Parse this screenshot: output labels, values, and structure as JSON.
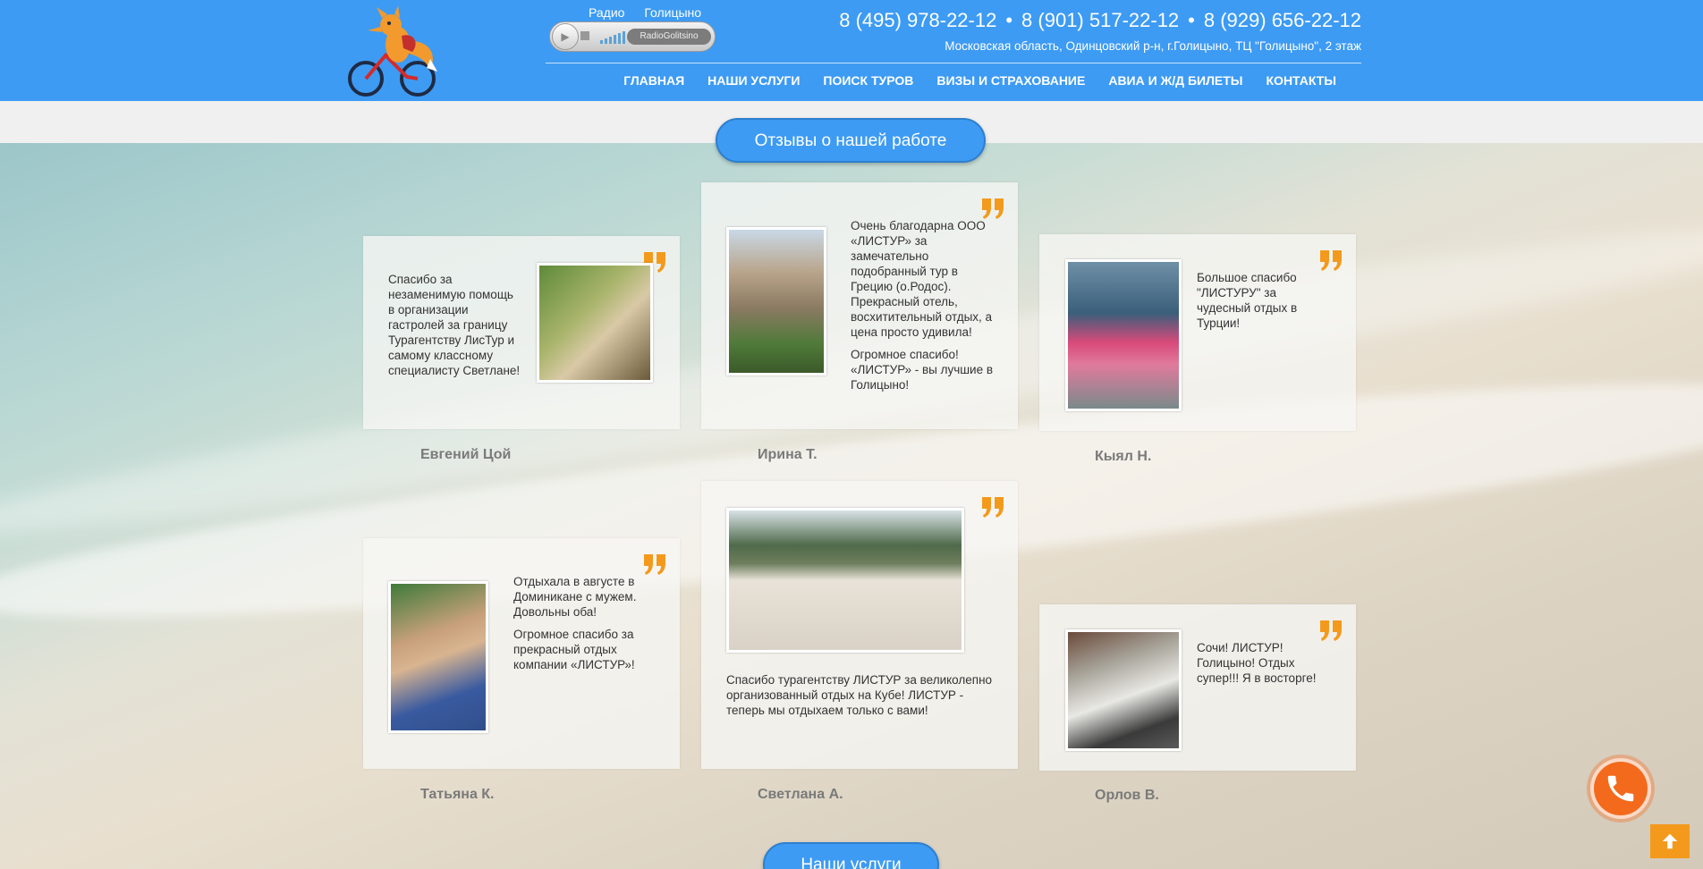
{
  "header": {
    "radio": {
      "label1": "Радио",
      "label2": "Голицыно",
      "station": "RadioGolitsino"
    },
    "phones": [
      "8 (495) 978-22-12",
      "8 (901) 517-22-12",
      "8 (929) 656-22-12"
    ],
    "phone_sep": "•",
    "address": "Московская область, Одинцовский р-н, г.Голицыно, ТЦ \"Голицыно\", 2 этаж",
    "nav": [
      "ГЛАВНАЯ",
      "НАШИ УСЛУГИ",
      "ПОИСК ТУРОВ",
      "ВИЗЫ И СТРАХОВАНИЕ",
      "АВИА И Ж/Д БИЛЕТЫ",
      "КОНТАКТЫ"
    ]
  },
  "reviews_title": "Отзывы о нашей работе",
  "services_title": "Наши услуги",
  "reviews": [
    {
      "name": "Евгений Цой",
      "paragraphs": [
        "Спасибо за незаменимую помощь в организации гастролей за границу Турагентству ЛисТур и самому классному специалисту Светлане!"
      ]
    },
    {
      "name": "Ирина Т.",
      "paragraphs": [
        "Очень благодарна ООО «ЛИСТУР» за замечательно подобранный тур в Грецию (о.Родос). Прекрасный отель, восхитительный отдых, а цена просто удивила!",
        "Огромное спасибо! «ЛИСТУР» - вы лучшие в Голицыно!"
      ]
    },
    {
      "name": "Кыял Н.",
      "paragraphs": [
        "Большое спасибо \"ЛИСТУРУ\" за чудесный отдых в Турции!"
      ]
    },
    {
      "name": "Татьяна К.",
      "paragraphs": [
        "Отдыхала в августе в Доминикане с мужем. Довольны оба!",
        "Огромное спасибо за прекрасный отдых компании «ЛИСТУР»!"
      ]
    },
    {
      "name": "Светлана А.",
      "paragraphs": [
        "Спасибо турагентству ЛИСТУР за великолепно организованный отдых на Кубе! ЛИСТУР - теперь мы отдыхаем только с вами!"
      ]
    },
    {
      "name": "Орлов В.",
      "paragraphs": [
        "Сочи! ЛИСТУР! Голицыно! Отдых супер!!! Я в восторге!"
      ]
    }
  ],
  "colors": {
    "header": "#3d9bf3",
    "accent": "#f39a1c",
    "call": "#f36a1c"
  }
}
